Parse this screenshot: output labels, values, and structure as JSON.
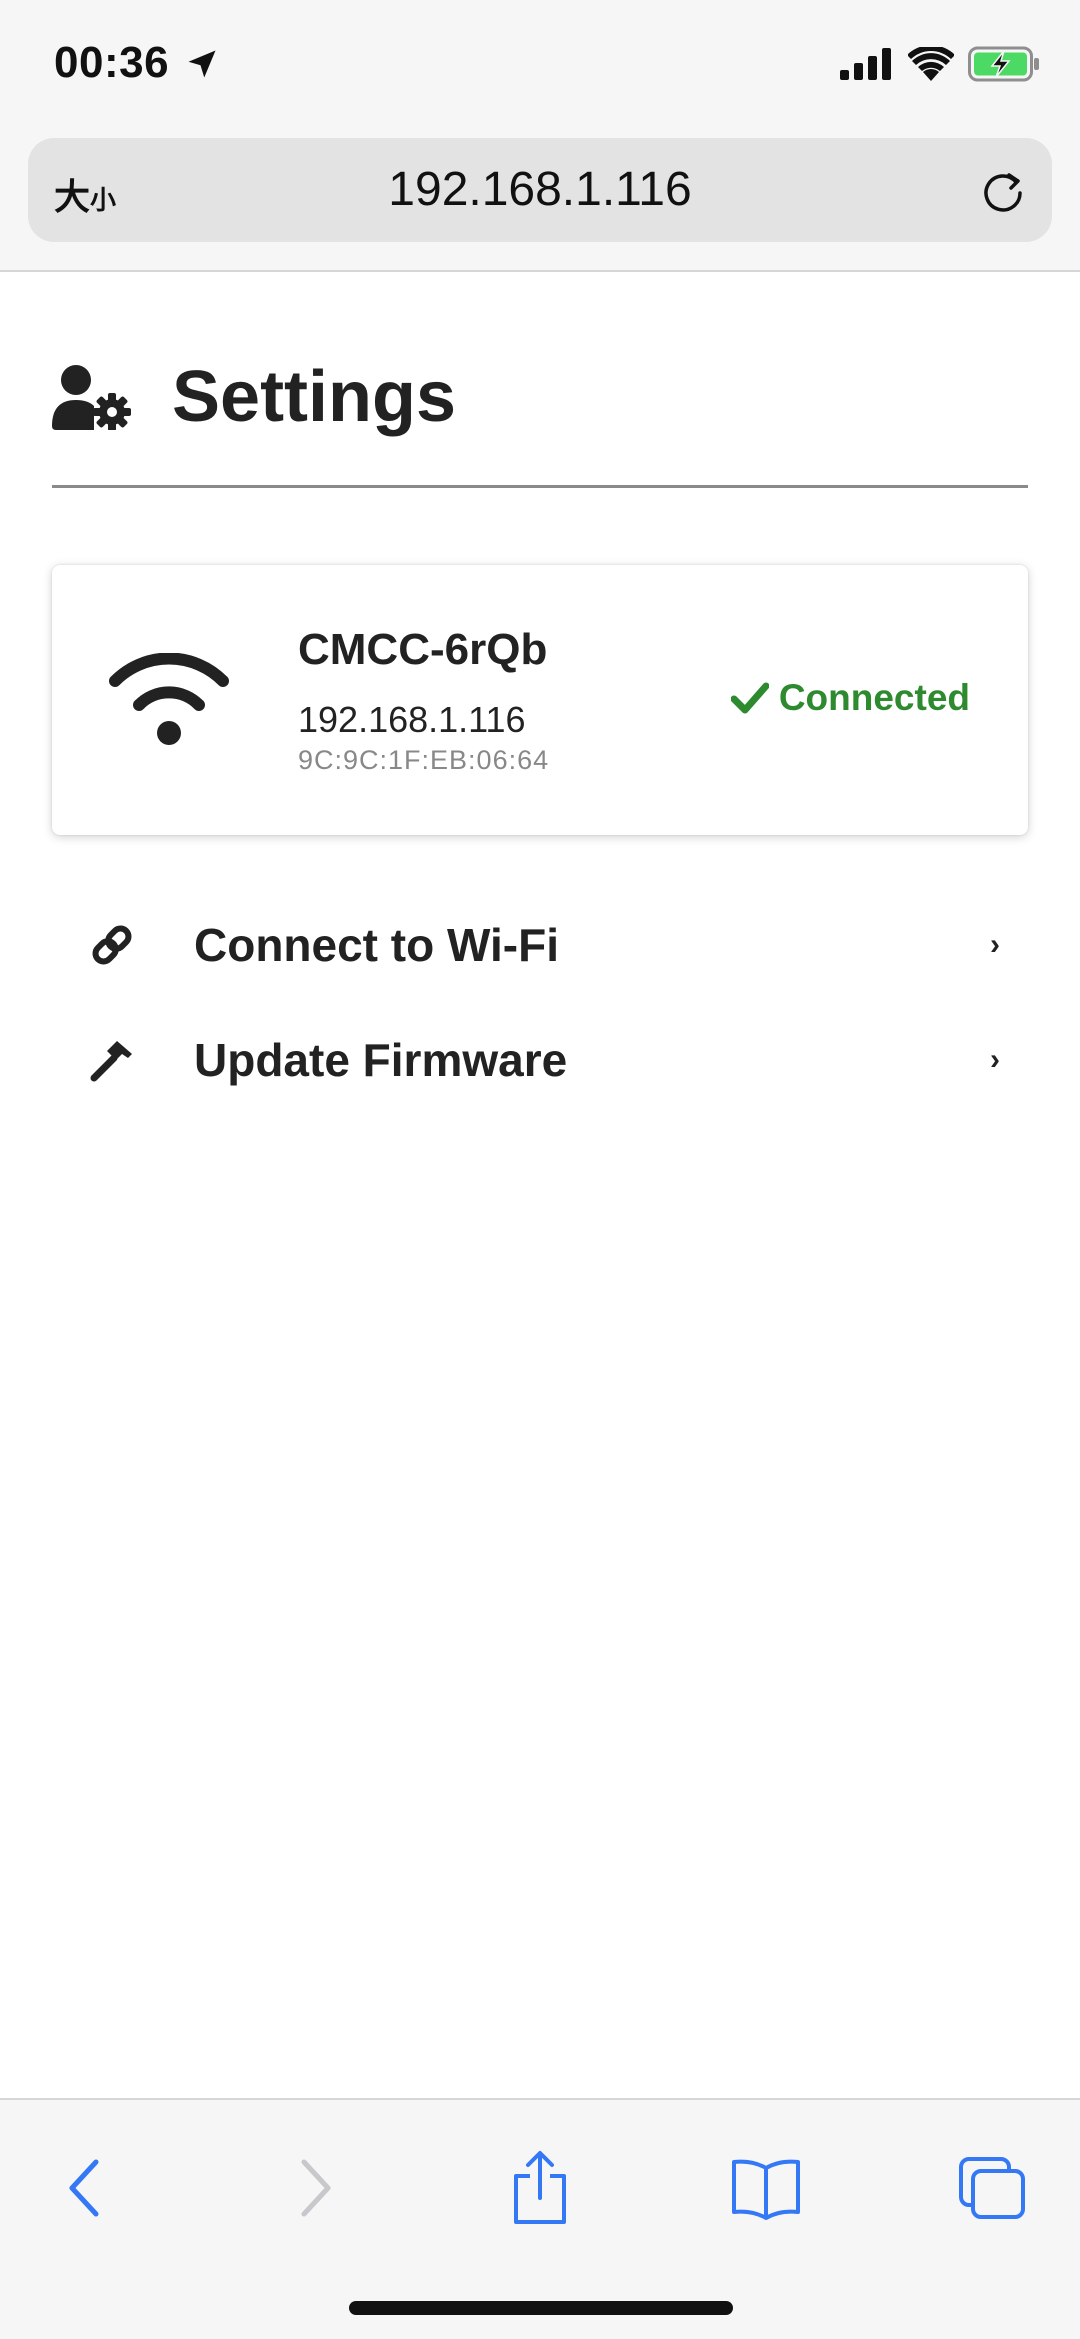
{
  "status_bar": {
    "time": "00:36"
  },
  "browser": {
    "text_size_label": "大",
    "text_size_label_small": "小",
    "url": "192.168.1.116"
  },
  "page": {
    "title": "Settings",
    "network": {
      "ssid": "CMCC-6rQb",
      "ip": "192.168.1.116",
      "mac": "9C:9C:1F:EB:06:64",
      "status": "Connected",
      "status_color": "#2e8a2e"
    },
    "menu": [
      {
        "label": "Connect to Wi-Fi",
        "icon": "link-icon",
        "chevron": "›"
      },
      {
        "label": "Update Firmware",
        "icon": "hammer-icon",
        "chevron": "›"
      }
    ]
  },
  "toolbar": {
    "accent": "#3478f6",
    "disabled": "#c7c7cc"
  }
}
